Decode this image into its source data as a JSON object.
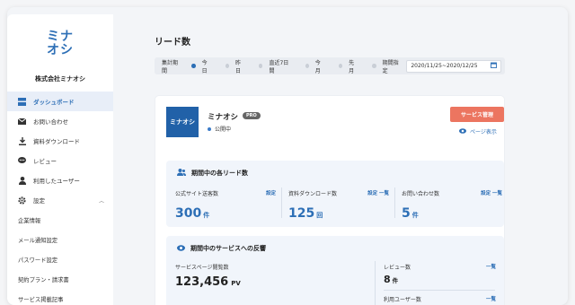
{
  "sidebar": {
    "logo_line1": "ミナ",
    "logo_line2": "オシ",
    "company": "株式会社ミナオシ",
    "items": [
      {
        "label": "ダッシュボード"
      },
      {
        "label": "お問い合わせ"
      },
      {
        "label": "資料ダウンロード"
      },
      {
        "label": "レビュー"
      },
      {
        "label": "利用したユーザー"
      },
      {
        "label": "設定"
      }
    ],
    "sub_items": [
      {
        "label": "企業情報"
      },
      {
        "label": "メール通知設定"
      },
      {
        "label": "パスワード設定"
      },
      {
        "label": "契約プラン・請求書"
      },
      {
        "label": "サービス掲載記事"
      }
    ]
  },
  "main": {
    "title": "リード数",
    "filter": {
      "label": "集計期間",
      "options": [
        "今日",
        "昨日",
        "直近7日間",
        "今月",
        "先月",
        "期間指定"
      ],
      "date_range": "2020/11/25~2020/12/25"
    }
  },
  "service": {
    "logo_text": "ミナオシ",
    "name": "ミナオシ",
    "badge": "PRO",
    "status": "公開中",
    "manage_button": "サービス管理",
    "page_link": "ページ表示"
  },
  "leads_panel": {
    "title": "期間中の各リード数",
    "metrics": [
      {
        "label": "公式サイト送客数",
        "links": "設定",
        "value": "300",
        "unit": "件"
      },
      {
        "label": "資料ダウンロード数",
        "links": "設定  一覧",
        "value": "125",
        "unit": "回"
      },
      {
        "label": "お問い合わせ数",
        "links": "設定  一覧",
        "value": "5",
        "unit": "件"
      }
    ]
  },
  "reaction_panel": {
    "title": "期間中のサービスへの反響",
    "page_views_label": "サービスページ閲覧数",
    "page_views_value": "123,456",
    "page_views_unit": "PV",
    "reviews_label": "レビュー数",
    "reviews_link": "一覧",
    "reviews_value": "8",
    "reviews_unit": "件",
    "users_label": "利用ユーザー数",
    "users_link": "一覧"
  },
  "colors": {
    "accent": "#2d6fb6",
    "button": "#ec7560",
    "panel_bg": "#f1f5fb"
  }
}
